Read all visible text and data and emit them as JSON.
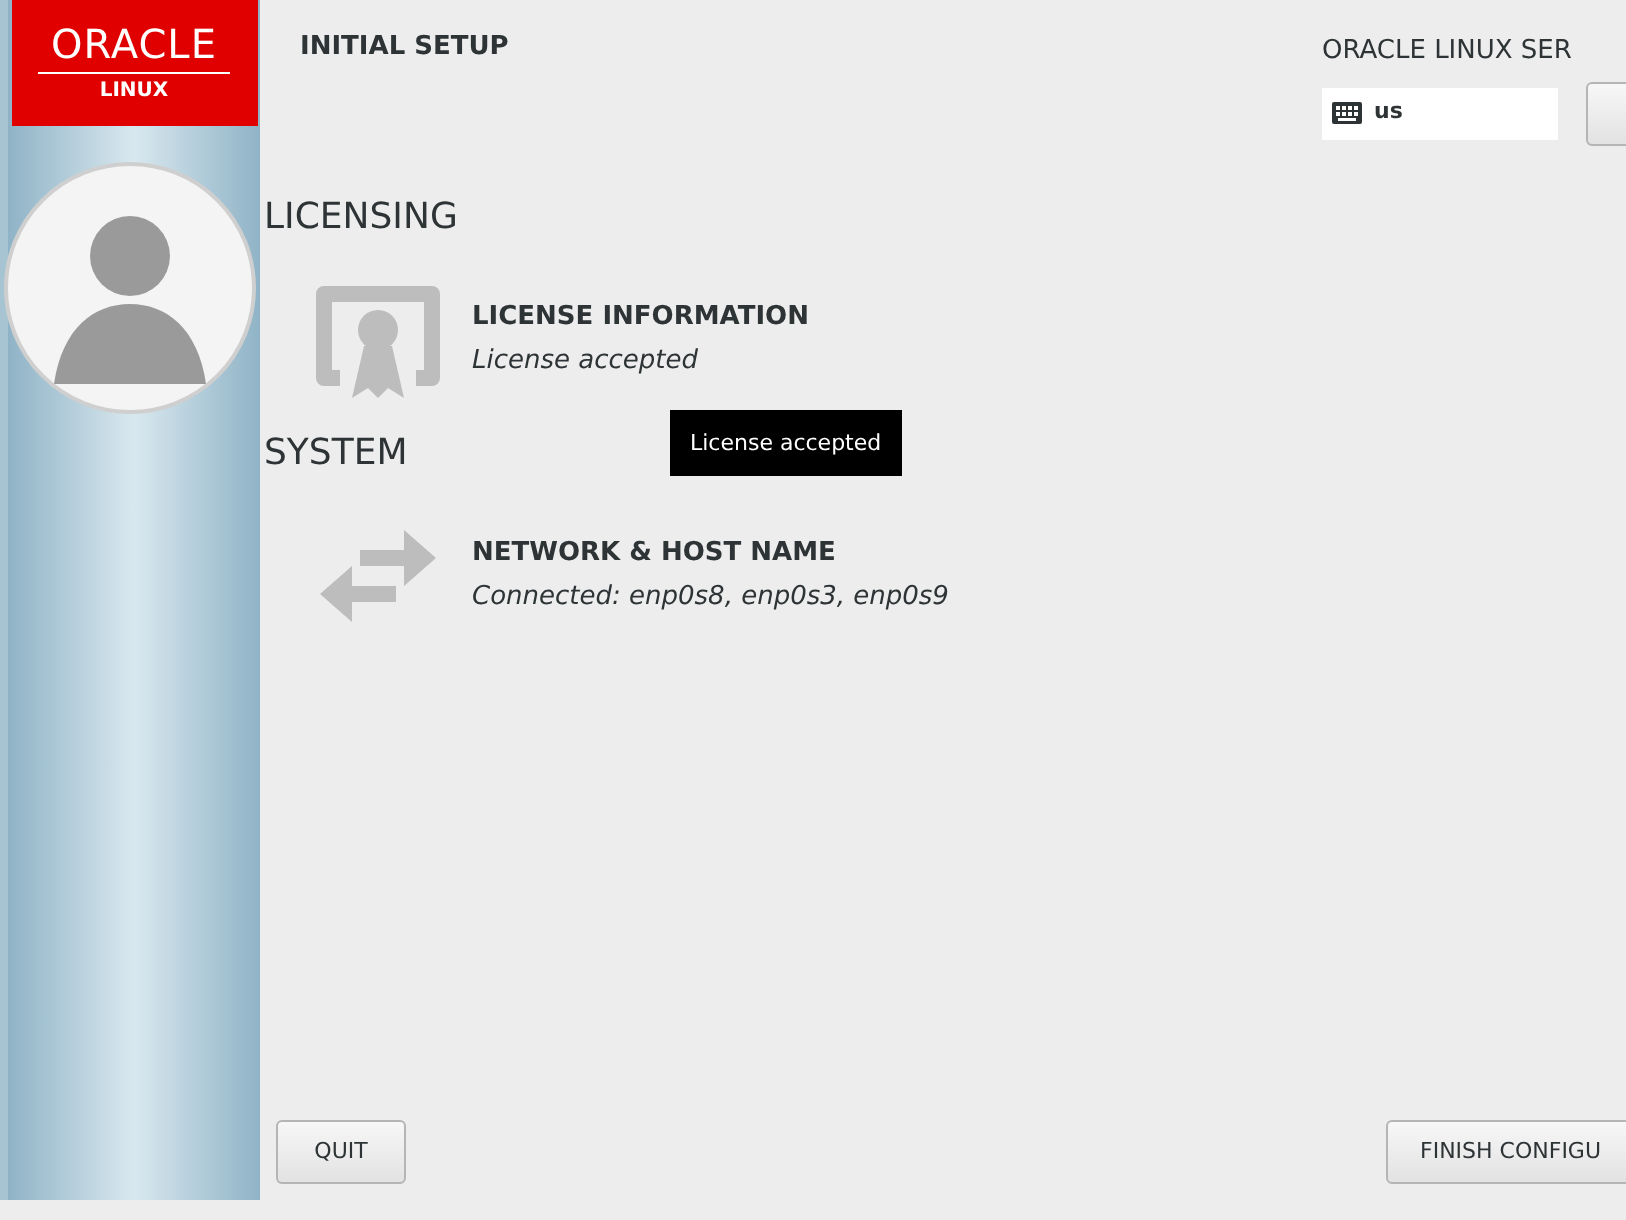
{
  "brand": {
    "name": "ORACLE",
    "product": "LINUX"
  },
  "header": {
    "title": "INITIAL SETUP",
    "product_title": "ORACLE LINUX SER",
    "keyboard_layout": "us"
  },
  "sections": [
    {
      "title": "LICENSING",
      "items": [
        {
          "kind": "license",
          "title": "LICENSE INFORMATION",
          "status": "License accepted"
        }
      ]
    },
    {
      "title": "SYSTEM",
      "items": [
        {
          "kind": "network",
          "title": "NETWORK & HOST NAME",
          "status": "Connected: enp0s8, enp0s3, enp0s9"
        }
      ]
    }
  ],
  "tooltip": "License accepted",
  "buttons": {
    "quit": "QUIT",
    "finish": "FINISH CONFIGU"
  }
}
